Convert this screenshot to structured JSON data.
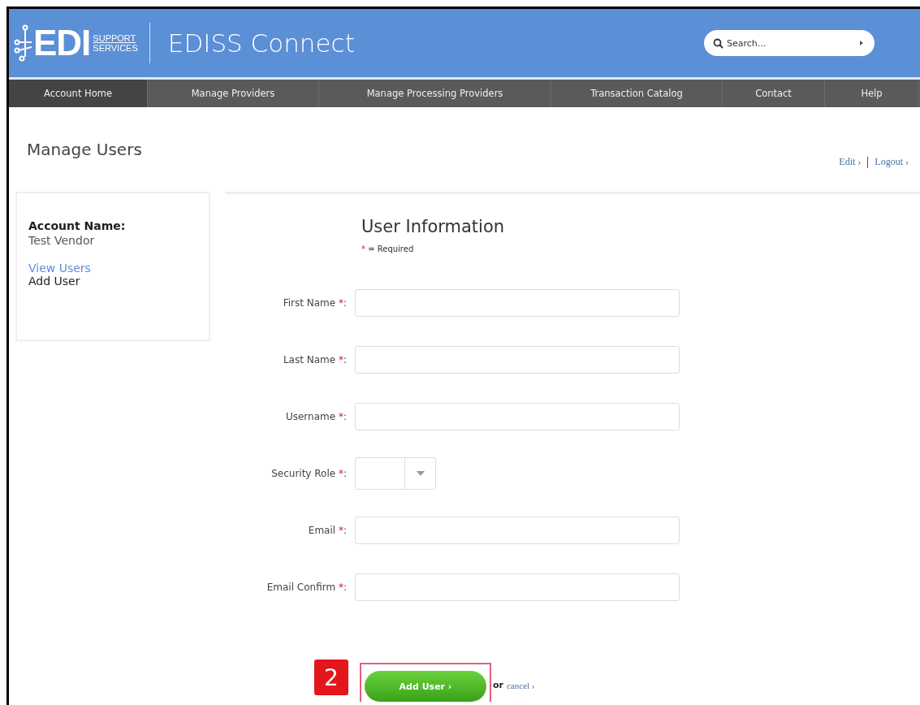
{
  "header": {
    "logo": {
      "mark": "EDI",
      "line_1": "SUPPORT",
      "line_2": "SERVICES"
    },
    "title": "EDISS Connect",
    "search": {
      "placeholder": "Search..."
    }
  },
  "nav": [
    {
      "label": "Account Home",
      "selected": true
    },
    {
      "label": "Manage Providers",
      "selected": false
    },
    {
      "label": "Manage Processing Providers",
      "selected": false
    },
    {
      "label": "Transaction Catalog",
      "selected": false
    },
    {
      "label": "Contact",
      "selected": false
    },
    {
      "label": "Help",
      "selected": false
    }
  ],
  "page_title": "Manage Users",
  "user_links": [
    {
      "label": "Edit ›"
    },
    {
      "label": "Logout ›"
    }
  ],
  "sidebar": {
    "account_label": "Account Name:",
    "account_name": "Test Vendor",
    "items": [
      {
        "label": "View Users",
        "selected": false
      },
      {
        "label": "Add User",
        "selected": true
      }
    ]
  },
  "form": {
    "title": "User Information",
    "legend": {
      "mark": "*",
      "text": "= Required"
    },
    "fields": [
      {
        "kind": "text",
        "label": "First Name",
        "mark": "*",
        "suffix": ":"
      },
      {
        "kind": "text",
        "label": "Last Name",
        "mark": "*",
        "suffix": ":"
      },
      {
        "kind": "text",
        "label": "Username",
        "mark": "*",
        "suffix": ":"
      },
      {
        "kind": "select",
        "label": "Security Role",
        "mark": "*",
        "suffix": ":"
      },
      {
        "kind": "text",
        "label": "Email",
        "mark": "*",
        "suffix": ":"
      },
      {
        "kind": "text",
        "label": "Email Confirm",
        "mark": "*",
        "suffix": ":"
      }
    ],
    "submit": "Add User ›",
    "or": "or",
    "cancel": "cancel ›"
  },
  "callout": {
    "number": "2"
  }
}
